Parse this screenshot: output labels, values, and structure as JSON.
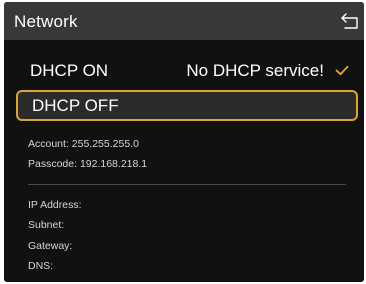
{
  "header": {
    "title": "Network",
    "back_icon": "back-return-icon"
  },
  "options": [
    {
      "label": "DHCP ON",
      "status": "No DHCP service!",
      "checked": true,
      "check_color": "#e9a52c"
    },
    {
      "label": "DHCP OFF",
      "focused": true,
      "focus_color": "#d9a43a"
    }
  ],
  "credentials": {
    "account": "Account: 255.255.255.0",
    "passcode": "Passcode: 192.168.218.1"
  },
  "network_info": {
    "ip_address": "IP Address:",
    "subnet": "Subnet:",
    "gateway": "Gateway:",
    "dns": "DNS:"
  }
}
